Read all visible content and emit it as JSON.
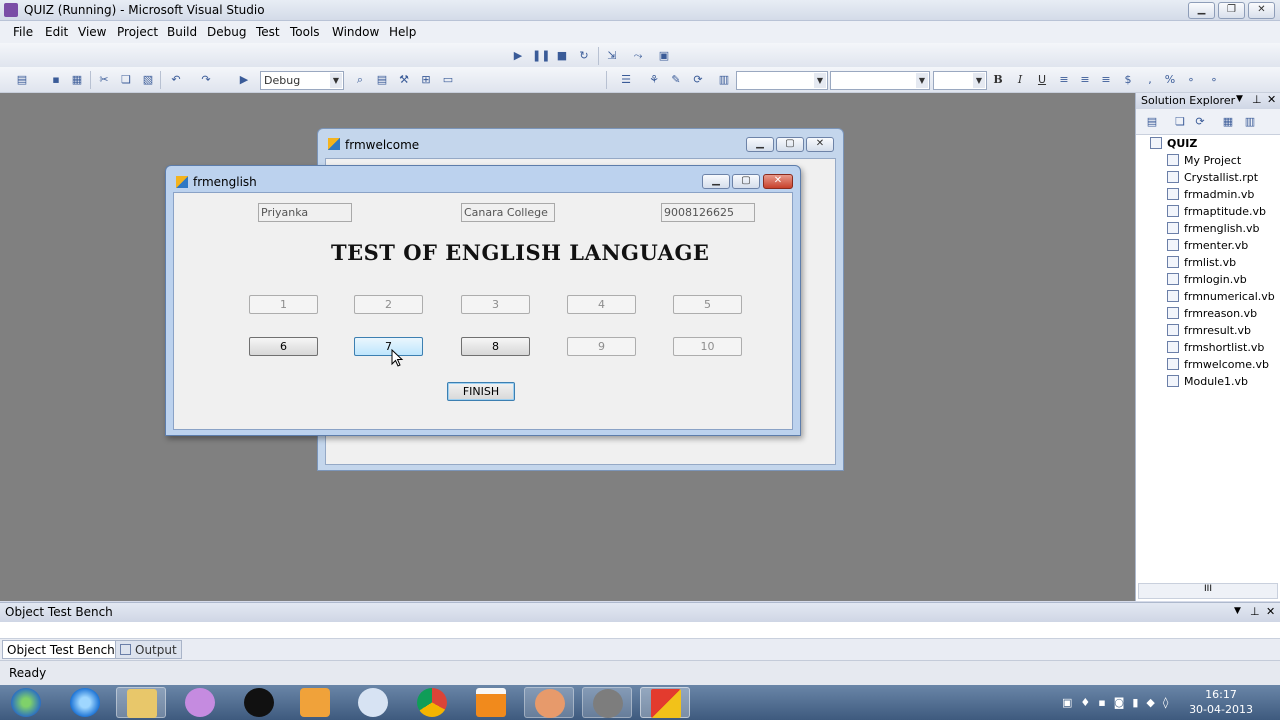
{
  "window": {
    "title": "QUIZ (Running) - Microsoft Visual Studio"
  },
  "menu": [
    "File",
    "Edit",
    "View",
    "Project",
    "Build",
    "Debug",
    "Test",
    "Tools",
    "Window",
    "Help"
  ],
  "toolbar": {
    "configuration": "Debug",
    "comma": ",",
    "percent": "%"
  },
  "solution_explorer": {
    "title": "Solution Explorer",
    "project": "QUIZ",
    "items": [
      "My Project",
      "Crystallist.rpt",
      "frmadmin.vb",
      "frmaptitude.vb",
      "frmenglish.vb",
      "frmenter.vb",
      "frmlist.vb",
      "frmlogin.vb",
      "frmnumerical.vb",
      "frmreason.vb",
      "frmresult.vb",
      "frmshortlist.vb",
      "frmwelcome.vb",
      "Module1.vb"
    ],
    "scroll_label": "III"
  },
  "frmwelcome": {
    "title": "frmwelcome"
  },
  "frmenglish": {
    "title": "frmenglish",
    "name_value": "Priyanka",
    "college_value": "Canara College",
    "phone_value": "9008126625",
    "heading": "TEST OF ENGLISH LANGUAGE",
    "questions": [
      {
        "label": "1",
        "state": "disabled"
      },
      {
        "label": "2",
        "state": "disabled"
      },
      {
        "label": "3",
        "state": "disabled"
      },
      {
        "label": "4",
        "state": "disabled"
      },
      {
        "label": "5",
        "state": "disabled"
      },
      {
        "label": "6",
        "state": "enabled"
      },
      {
        "label": "7",
        "state": "hover"
      },
      {
        "label": "8",
        "state": "enabled"
      },
      {
        "label": "9",
        "state": "disabled"
      },
      {
        "label": "10",
        "state": "disabled"
      }
    ],
    "finish_label": "FINISH"
  },
  "bottom_panel": {
    "title": "Object Test Bench",
    "tabs": [
      "Object Test Bench",
      "Output"
    ]
  },
  "status": {
    "text": "Ready"
  },
  "taskbar": {
    "time": "16:17",
    "date": "30-04-2013"
  }
}
